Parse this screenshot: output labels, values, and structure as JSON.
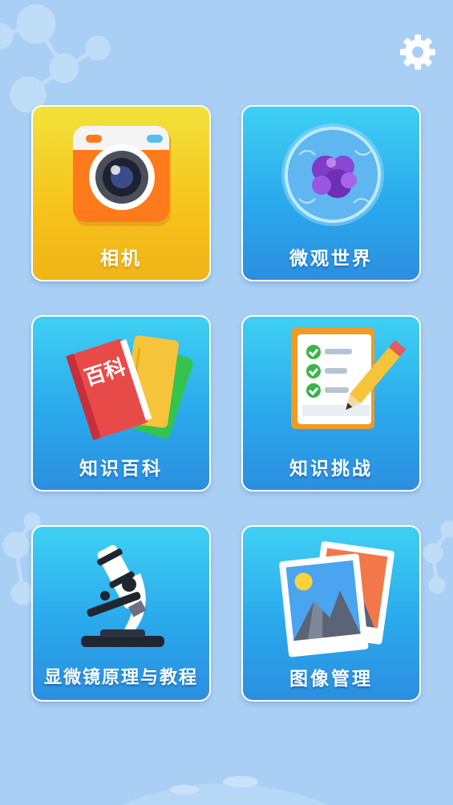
{
  "app": {
    "settings_icon": "gear-icon",
    "background_color": "#a9cff5"
  },
  "tiles": [
    {
      "label": "相机",
      "icon": "camera-icon",
      "color": "#f4c71c"
    },
    {
      "label": "微观世界",
      "icon": "cell-icon",
      "color": "#2aa9ec"
    },
    {
      "label": "知识百科",
      "icon": "encyclopedia-book-icon",
      "icon_text": "百科",
      "color": "#2aa9ec"
    },
    {
      "label": "知识挑战",
      "icon": "quiz-checklist-icon",
      "color": "#2aa9ec"
    },
    {
      "label": "显微镜原理与教程",
      "icon": "microscope-icon",
      "color": "#2aa9ec"
    },
    {
      "label": "图像管理",
      "icon": "photo-gallery-icon",
      "color": "#2aa9ec"
    }
  ]
}
